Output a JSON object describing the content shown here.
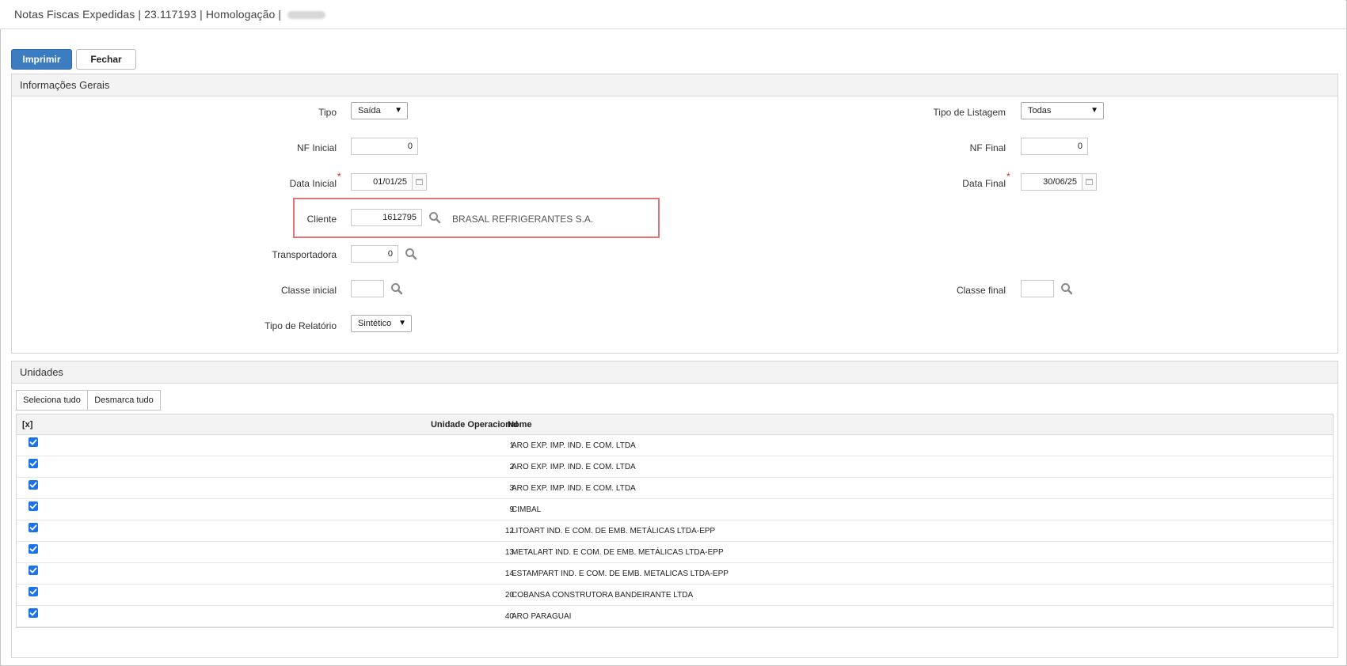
{
  "window": {
    "title": "Notas Fiscas Expedidas | 23.117193 | Homologação |"
  },
  "toolbar": {
    "print_label": "Imprimir",
    "close_label": "Fechar"
  },
  "general": {
    "heading": "Informações Gerais",
    "tipo": {
      "label": "Tipo",
      "value": "Saída"
    },
    "tipo_listagem": {
      "label": "Tipo de Listagem",
      "value": "Todas"
    },
    "nf_inicial": {
      "label": "NF Inicial",
      "value": "0"
    },
    "nf_final": {
      "label": "NF Final",
      "value": "0"
    },
    "data_inicial": {
      "label": "Data Inicial",
      "value": "01/01/25",
      "required": "*"
    },
    "data_final": {
      "label": "Data Final",
      "value": "30/06/25",
      "required": "*"
    },
    "cliente": {
      "label": "Cliente",
      "value": "1612795",
      "description": "BRASAL REFRIGERANTES S.A."
    },
    "transportadora": {
      "label": "Transportadora",
      "value": "0"
    },
    "classe_inicial": {
      "label": "Classe inicial",
      "value": ""
    },
    "classe_final": {
      "label": "Classe final",
      "value": ""
    },
    "tipo_relatorio": {
      "label": "Tipo de Relatório",
      "value": "Sintético"
    }
  },
  "units": {
    "heading": "Unidades",
    "select_all_label": "Seleciona tudo",
    "deselect_all_label": "Desmarca tudo",
    "columns": {
      "check": "[x]",
      "unit": "Unidade Operacional",
      "name": "Nome"
    },
    "rows": [
      {
        "checked": true,
        "unit": "1",
        "name": "ARO EXP. IMP. IND. E COM. LTDA"
      },
      {
        "checked": true,
        "unit": "2",
        "name": "ARO EXP. IMP. IND. E COM. LTDA"
      },
      {
        "checked": true,
        "unit": "3",
        "name": "ARO EXP. IMP. IND. E COM. LTDA"
      },
      {
        "checked": true,
        "unit": "9",
        "name": "CIMBAL"
      },
      {
        "checked": true,
        "unit": "12",
        "name": "LITOART IND. E COM. DE EMB. METÁLICAS LTDA-EPP"
      },
      {
        "checked": true,
        "unit": "13",
        "name": "METALART IND. E COM. DE EMB. METÁLICAS LTDA-EPP"
      },
      {
        "checked": true,
        "unit": "14",
        "name": "ESTAMPART IND. E COM. DE EMB. METALICAS LTDA-EPP"
      },
      {
        "checked": true,
        "unit": "20",
        "name": "COBANSA CONSTRUTORA BANDEIRANTE LTDA"
      },
      {
        "checked": true,
        "unit": "40",
        "name": "ARO PARAGUAI"
      }
    ]
  },
  "colors": {
    "accent": "#3b7dc0",
    "checkbox": "#1a73e8",
    "highlight": "#e57373",
    "required": "#e02020"
  }
}
